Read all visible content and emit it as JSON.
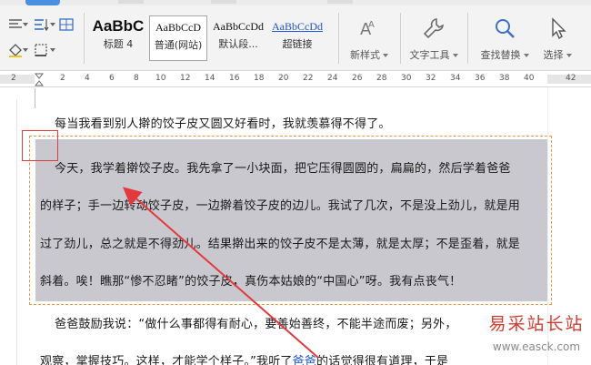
{
  "ribbon": {
    "styles": [
      {
        "sample": "AaBbC",
        "label": "标题 4"
      },
      {
        "sample": "AaBbCcD",
        "label": "普通(网站)"
      },
      {
        "sample": "AaBbCcDd",
        "label": "默认段..."
      },
      {
        "sample": "AaBbCcDd",
        "label": "超链接"
      }
    ],
    "new_style_label": "新样式",
    "text_tools_label": "文字工具",
    "find_replace_label": "查找替换",
    "select_label": "选择"
  },
  "ruler": {
    "numbers": [
      "2",
      "2",
      "4",
      "6",
      "8",
      "10",
      "12",
      "14",
      "16",
      "18",
      "20",
      "22",
      "24",
      "26",
      "28",
      "30",
      "32",
      "34",
      "36",
      "38",
      "40",
      "42"
    ]
  },
  "document": {
    "lines": [
      "每当我看到别人擀的饺子皮又圆又好看时，我就羡慕得不得了。",
      "今天，我学着擀饺子皮。我先拿了一小块面，把它压得圆圆的，扁扁的，然后学着爸爸",
      "的样子；手一边转动饺子皮，一边擀着饺子皮的边儿。我试了几次，不是没上劲儿，就是用",
      "过了劲儿，总之就是不得劲儿。结果擀出来的饺子皮不是太薄，就是太厚；不是歪着，就是",
      "斜着。唉！瞧那“惨不忍睹”的饺子皮，真伤本姑娘的“中国心”呀。我有点丧气！",
      "爸爸鼓励我说：“做什么事都得有耐心，要善始善终，不能半途而废；另外，",
      "观察，掌握技巧。这样，才能学个样子。”我听了"
    ],
    "link_word": "爸爸",
    "last_line_tail": "的话觉得很有道理，于是"
  },
  "watermark": {
    "title": "易采站长站",
    "url": "www.easck.com"
  },
  "colors": {
    "selection": "#c8c8ce",
    "highlight_box": "#e23b3b",
    "arrow": "#e3393d",
    "wavy_border": "#e79a43",
    "watermark_red": "#d63a2f"
  }
}
